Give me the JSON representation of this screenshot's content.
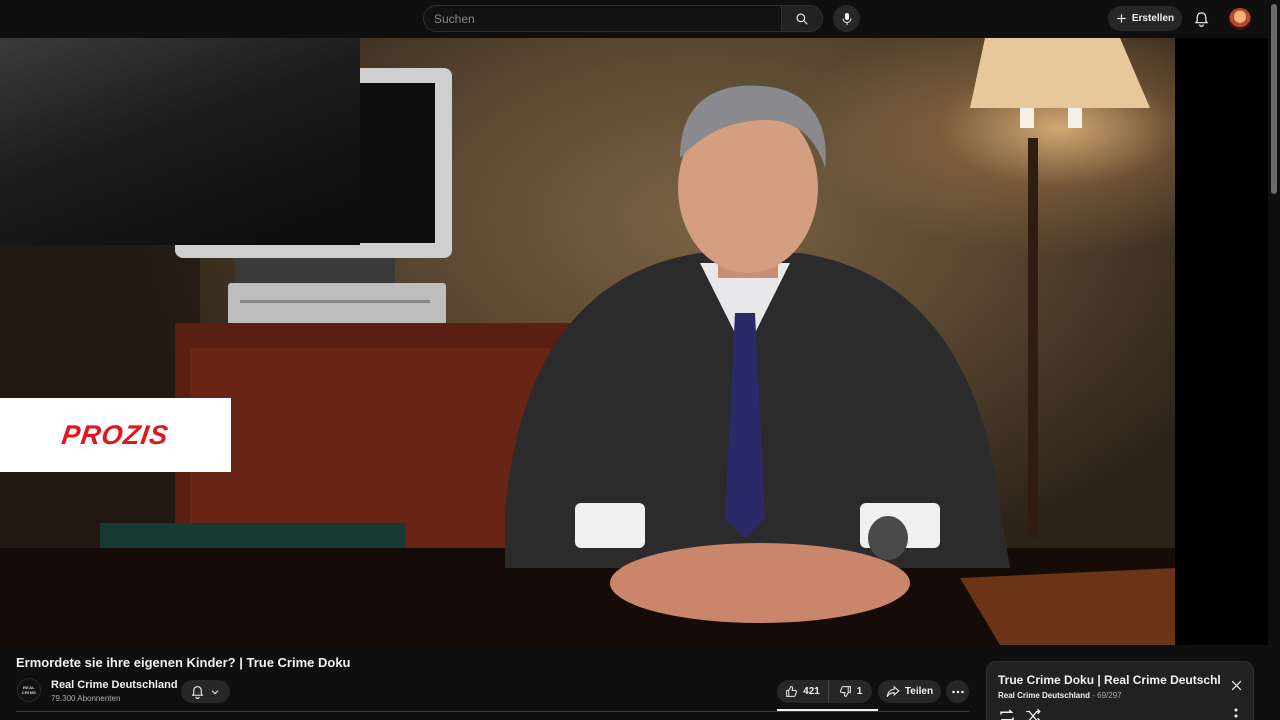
{
  "search": {
    "placeholder": "Suchen"
  },
  "header": {
    "create_label": "Erstellen"
  },
  "ad": {
    "brand_text": "PROZIS"
  },
  "video": {
    "title": "Ermordete sie ihre eigenen Kinder? | True Crime Doku"
  },
  "channel": {
    "name": "Real Crime Deutschland",
    "subscribers": "79.300 Abonnenten",
    "logo_text": [
      "REAL",
      "CRIME"
    ]
  },
  "actions": {
    "like_count": "421",
    "dislike_count": "1",
    "share_label": "Teilen"
  },
  "playlist": {
    "title": "True Crime Doku | Real Crime Deutschland",
    "channel": "Real Crime Deutschland",
    "position": "69/297"
  },
  "icons": {
    "search": "search-icon",
    "mic": "mic-icon",
    "create": "plus-icon",
    "notifications": "bell-icon",
    "like": "thumbs-up-icon",
    "dislike": "thumbs-down-icon",
    "share": "share-icon",
    "more": "more-horizontal-icon",
    "close": "close-icon",
    "loop": "loop-icon",
    "shuffle": "shuffle-icon"
  },
  "colors": {
    "background": "#0f0f0f",
    "button_bg": "#272727",
    "ad_brand_red": "#e3151b"
  }
}
